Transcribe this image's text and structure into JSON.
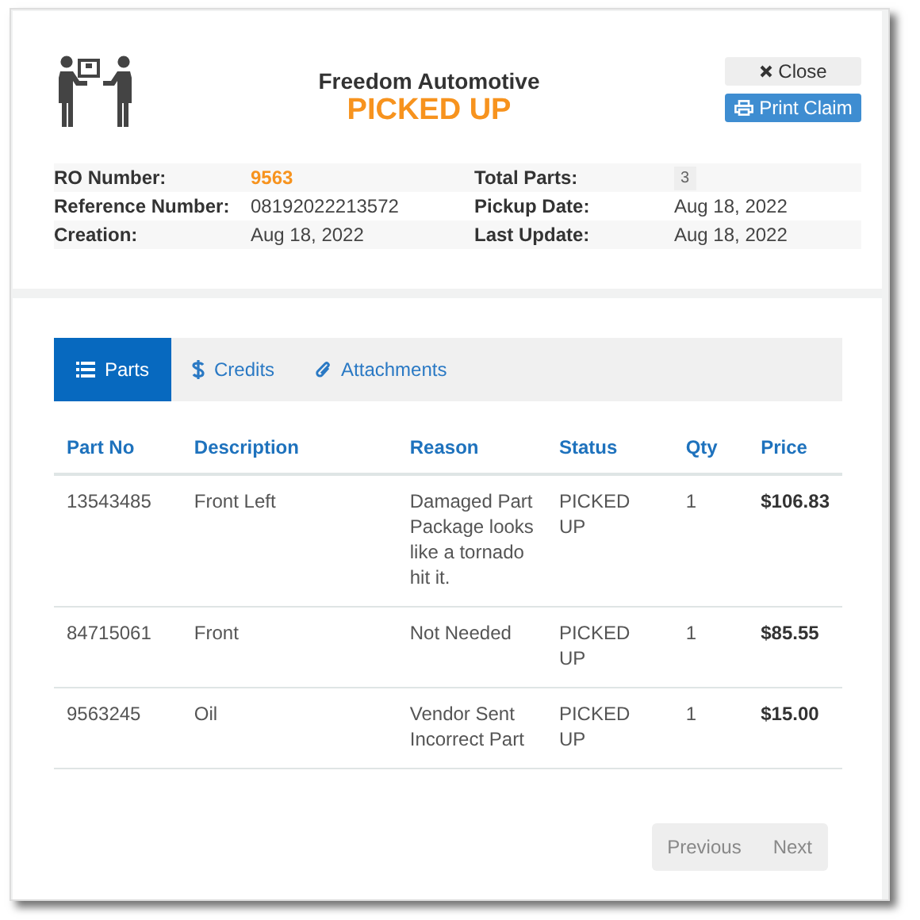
{
  "header": {
    "company": "Freedom Automotive",
    "status": "PICKED UP",
    "buttons": [
      {
        "kind": "close",
        "label": "Close"
      },
      {
        "kind": "print",
        "label": "Print Claim"
      }
    ]
  },
  "details": [
    [
      {
        "label": "RO Number:",
        "value": "9563",
        "kind": "highlight"
      },
      {
        "label": "Total Parts:",
        "value": "3",
        "kind": "badge"
      }
    ],
    [
      {
        "label": "Reference Number:",
        "value": "08192022213572",
        "kind": "plain"
      },
      {
        "label": "Pickup Date:",
        "value": "Aug 18, 2022",
        "kind": "plain"
      }
    ],
    [
      {
        "label": "Creation:",
        "value": "Aug 18, 2022",
        "kind": "plain"
      },
      {
        "label": "Last Update:",
        "value": "Aug 18, 2022",
        "kind": "plain"
      }
    ]
  ],
  "tabs": [
    {
      "kind": "list",
      "label": "Parts",
      "selected": true
    },
    {
      "kind": "dollar",
      "label": "Credits",
      "selected": false
    },
    {
      "kind": "clip",
      "label": "Attachments",
      "selected": false
    }
  ],
  "table": {
    "columns": [
      "Part No",
      "Description",
      "Reason",
      "Status",
      "Qty",
      "Price"
    ],
    "rows": [
      [
        "13543485",
        "Front Left",
        "Damaged Part Package looks like a tornado hit it.",
        "PICKED UP",
        "1",
        "$106.83"
      ],
      [
        "84715061",
        "Front",
        "Not Needed",
        "PICKED UP",
        "1",
        "$85.55"
      ],
      [
        "9563245",
        "Oil",
        "Vendor Sent Incorrect Part",
        "PICKED UP",
        "1",
        "$15.00"
      ]
    ]
  },
  "pager": [
    {
      "label": "Previous",
      "disabled": true
    },
    {
      "label": "Next",
      "disabled": true
    }
  ]
}
